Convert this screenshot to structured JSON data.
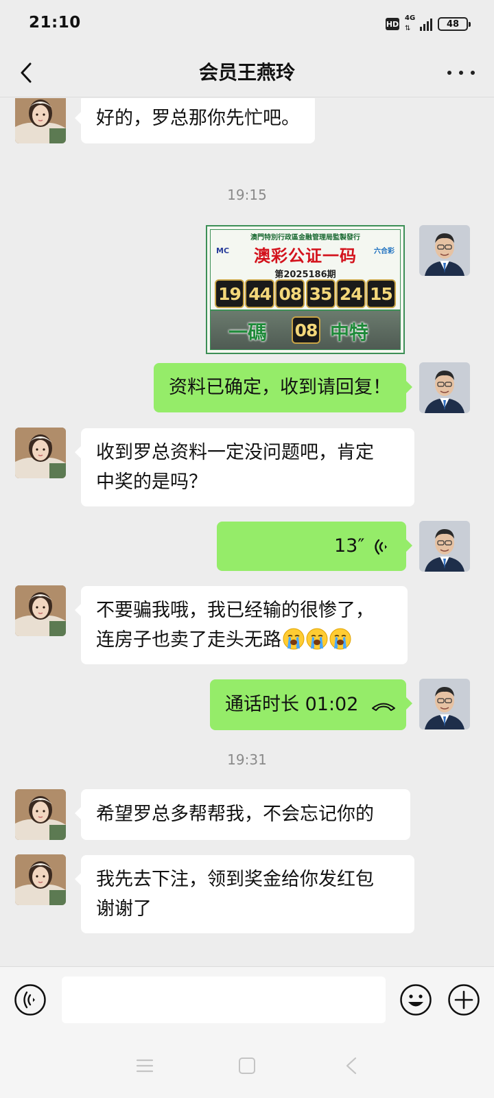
{
  "status_bar": {
    "time": "21:10",
    "hd_label": "HD",
    "network_label": "4G",
    "battery_level": "48"
  },
  "header": {
    "title": "会员王燕玲"
  },
  "messages": {
    "m1": "好的，罗总那你先忙吧。",
    "ts1": "19:15",
    "lotto": {
      "header_text": "澳門特別行政區金融管理局監製發行",
      "title": "澳彩公证一码",
      "logo_left": "MC",
      "logo_right": "六合彩",
      "issue": "第2025186期",
      "numbers": [
        "19",
        "44",
        "08",
        "35",
        "24",
        "15"
      ],
      "bottom_left": "一碼",
      "code": "08",
      "bottom_right": "中特"
    },
    "m2": "资料已确定，收到请回复！",
    "m3_line1": "收到罗总资料一定没问题吧，肯定",
    "m3_line2": "中奖的是吗？",
    "voice_duration": "13″",
    "m5_line1": "不要骗我哦，我已经输的很惨了，",
    "m5_line2": "连房子也卖了走头无路",
    "call_label": "通话时长 01:02",
    "ts2": "19:31",
    "m7": "希望罗总多帮帮我，不会忘记你的",
    "m8_line1": "我先去下注，领到奖金给你发红包",
    "m8_line2": "谢谢了"
  },
  "icons": {
    "back": "chevron-left-icon",
    "more": "more-dots-icon",
    "voice_message": "voice-wave-icon",
    "call": "phone-hangup-icon",
    "crying_emoji": "crying-face-emoji",
    "voice_input": "voice-input-icon",
    "emoji_button": "smiley-icon",
    "plus": "plus-circle-icon"
  },
  "colors": {
    "sent_bubble": "#95ec69",
    "received_bubble": "#ffffff",
    "background": "#ededed"
  }
}
